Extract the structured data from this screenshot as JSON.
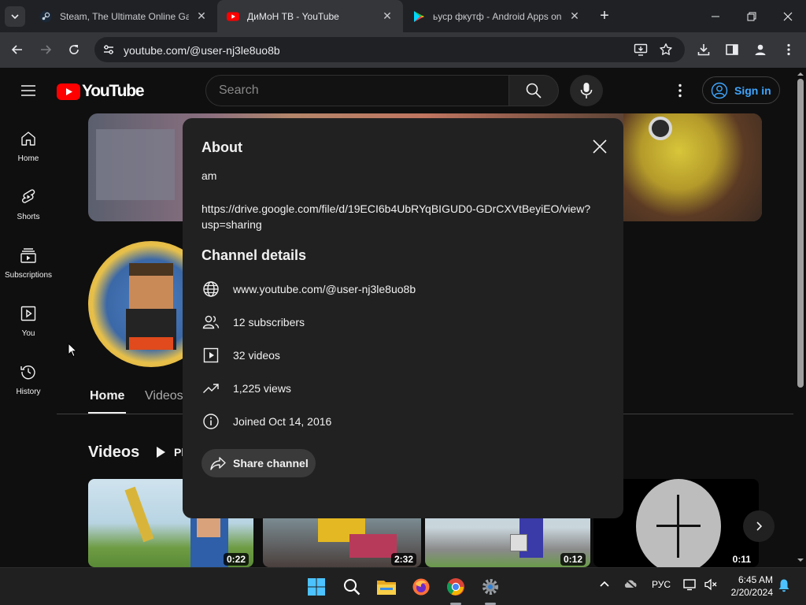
{
  "browser": {
    "tabs": [
      {
        "title": "Steam, The Ultimate Online Gar",
        "favicon": "steam-icon",
        "active": false
      },
      {
        "title": "ДиМоН ТВ - YouTube",
        "favicon": "youtube-icon",
        "active": true
      },
      {
        "title": "ьуср фкутф - Android Apps on",
        "favicon": "google-play-icon",
        "active": false
      }
    ],
    "url": "youtube.com/@user-nj3le8uo8b"
  },
  "youtube": {
    "logo_text": "YouTube",
    "search_placeholder": "Search",
    "sign_in_label": "Sign in",
    "guide": [
      {
        "label": "Home",
        "icon": "home-icon"
      },
      {
        "label": "Shorts",
        "icon": "shorts-icon"
      },
      {
        "label": "Subscriptions",
        "icon": "subscriptions-icon"
      },
      {
        "label": "You",
        "icon": "you-icon"
      },
      {
        "label": "History",
        "icon": "history-icon"
      }
    ],
    "channel_tabs": [
      "Home",
      "Videos"
    ],
    "videos_heading": "Videos",
    "play_all_partial": "Pl",
    "videos": [
      {
        "duration": "0:22"
      },
      {
        "duration": "2:32"
      },
      {
        "duration": "0:12"
      },
      {
        "duration": "0:11"
      }
    ]
  },
  "about_dialog": {
    "title": "About",
    "description": "am",
    "link": "https://drive.google.com/file/d/19ECI6b4UbRYqBIGUD0-GDrCXVtBeyiEO/view?usp=sharing",
    "details_heading": "Channel details",
    "details": [
      {
        "icon": "globe-icon",
        "text": "www.youtube.com/@user-nj3le8uo8b"
      },
      {
        "icon": "subscribers-icon",
        "text": "12 subscribers"
      },
      {
        "icon": "video-icon",
        "text": "32 videos"
      },
      {
        "icon": "trending-icon",
        "text": "1,225 views"
      },
      {
        "icon": "info-icon",
        "text": "Joined Oct 14, 2016"
      }
    ],
    "share_label": "Share channel"
  },
  "taskbar": {
    "language": "РУС",
    "time": "6:45 AM",
    "date": "2/20/2024"
  }
}
